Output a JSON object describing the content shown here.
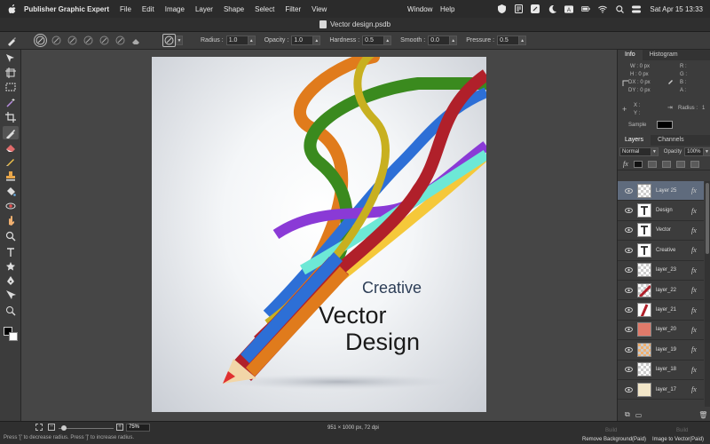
{
  "menubar": {
    "app": "Publisher Graphic Expert",
    "items": [
      "File",
      "Edit",
      "Image",
      "Layer",
      "Shape",
      "Select",
      "Filter",
      "View"
    ],
    "window_menu": "Window",
    "help_menu": "Help",
    "clock": "Sat Apr 15  13:33"
  },
  "window": {
    "title": "Vector design.psdb"
  },
  "options": {
    "radius_label": "Radius :",
    "radius": "1.0",
    "opacity_label": "Opacity :",
    "opacity": "1.0",
    "hardness_label": "Hardness :",
    "hardness": "0.5",
    "smooth_label": "Smooth :",
    "smooth": "0.0",
    "pressure_label": "Pressure :",
    "pressure": "0.5"
  },
  "canvas": {
    "text_creative": "Creative",
    "text_vector": "Vector",
    "text_design": "Design",
    "doc_info": "951 × 1000 px, 72 dpi"
  },
  "info_panel": {
    "tab_info": "Info",
    "tab_histogram": "Histogram",
    "w": "W :  0 px",
    "h": "H :  0 px",
    "dx": "DX :  0 px",
    "dy": "DY :  0 px",
    "r": "R :",
    "g": "G :",
    "b": "B :",
    "a": "A :",
    "x": "X :",
    "y": "Y :",
    "radius_label": "Radius :",
    "radius": "1",
    "sample_label": "Sample"
  },
  "layers_panel": {
    "tab_layers": "Layers",
    "tab_channels": "Channels",
    "blend_mode": "Normal",
    "opacity_label": "Opacity",
    "opacity": "100%",
    "fx": "fx",
    "layers": [
      {
        "name": "Layer 25",
        "thumb": "checker",
        "active": true
      },
      {
        "name": "Design",
        "thumb": "text"
      },
      {
        "name": "Vector",
        "thumb": "text"
      },
      {
        "name": "Creative",
        "thumb": "text"
      },
      {
        "name": "layer_23",
        "thumb": "checker"
      },
      {
        "name": "layer_22",
        "thumb": "red-stroke"
      },
      {
        "name": "layer_21",
        "thumb": "red-pencil"
      },
      {
        "name": "layer_20",
        "thumb": "salmon"
      },
      {
        "name": "layer_19",
        "thumb": "checker-orange"
      },
      {
        "name": "layer_18",
        "thumb": "checker"
      },
      {
        "name": "layer_17",
        "thumb": "cream"
      }
    ]
  },
  "statusbar": {
    "hint": "Press '[' to decrease radius. Press ']' to increase radius.",
    "zoom": "75%",
    "remove_bg_build": "Build",
    "remove_bg": "Remove Background(Paid)",
    "img_to_vector_build": "Build",
    "img_to_vector": "Image to Vector(Paid)"
  },
  "colors": {
    "accent_layer_row": "#5f6b7d",
    "foreground": "#000000",
    "background": "#ffffff"
  }
}
